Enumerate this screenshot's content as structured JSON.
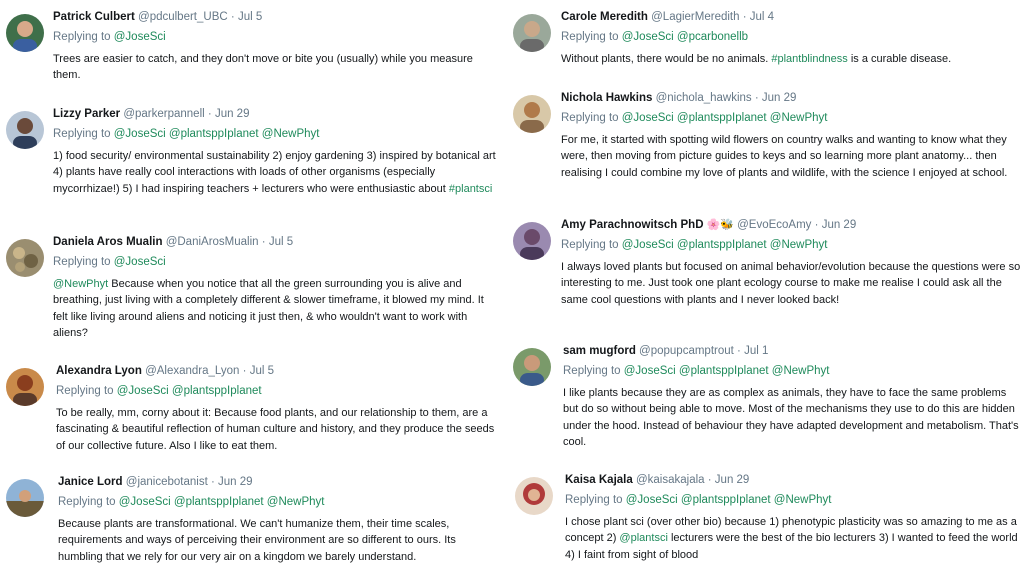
{
  "left_column": [
    {
      "name": "Patrick Culbert",
      "handle": "@pdculbert_UBC",
      "date": "Jul 5",
      "replying_label": "Replying to",
      "mentions": [
        "@JoseSci"
      ],
      "text_parts": [
        "Trees are easier to catch, and they don't move or bite you (usually) while you measure them."
      ],
      "avatar_color": "#4a7fb0"
    },
    {
      "name": "Lizzy Parker",
      "handle": "@parkerpannell",
      "date": "Jun 29",
      "replying_label": "Replying to",
      "mentions": [
        "@JoseSci",
        "@plantsppIplanet",
        "@NewPhyt"
      ],
      "text_parts": [
        "1) food security/ environmental sustainability 2) enjoy gardening 3) inspired by botanical art 4) plants have really cool interactions with loads of other organisms (especially mycorrhizae!) 5) I had inspiring teachers + lecturers who were enthusiastic about ",
        "#plantsci"
      ],
      "avatar_color": "#5a6e8c"
    },
    {
      "name": "Daniela Aros Mualin",
      "handle": "@DaniArosMualin",
      "date": "Jul 5",
      "replying_label": "Replying to",
      "mentions": [
        "@JoseSci"
      ],
      "text_parts": [
        "@NewPhyt",
        " Because when you notice that all the green surrounding you is alive and breathing, just living with a completely different & slower timeframe, it blowed my mind. It felt like living around aliens and noticing it just then, & who wouldn't want to work with aliens?"
      ],
      "avatar_color": "#8a7a5a"
    },
    {
      "name": "Alexandra Lyon",
      "handle": "@Alexandra_Lyon",
      "date": "Jul 5",
      "replying_label": "Replying to",
      "mentions": [
        "@JoseSci",
        "@plantsppIplanet"
      ],
      "text_parts": [
        "To be really, mm, corny about it: Because food plants, and our relationship to them, are a fascinating & beautiful reflection of human culture and history, and they produce the seeds of our collective future. Also I like to eat them."
      ],
      "avatar_color": "#b5652e"
    },
    {
      "name": "Janice Lord",
      "handle": "@janicebotanist",
      "date": "Jun 29",
      "replying_label": "Replying to",
      "mentions": [
        "@JoseSci",
        "@plantsppIplanet",
        "@NewPhyt"
      ],
      "text_parts": [
        "Because plants are transformational. We can't humanize them, their time scales, requirements and ways of perceiving their environment are so different to ours. Its humbling that we rely for our very air on a kingdom we barely understand."
      ],
      "avatar_color": "#6a8fb8"
    }
  ],
  "right_column": [
    {
      "name": "Carole Meredith",
      "handle": "@LagierMeredith",
      "date": "Jul 4",
      "replying_label": "Replying to",
      "mentions": [
        "@JoseSci",
        "@pcarbonellb"
      ],
      "text_parts": [
        "Without plants, there would be no animals. ",
        "#plantblindness",
        " is a curable disease."
      ],
      "avatar_color": "#7a8a7a"
    },
    {
      "name": "Nichola Hawkins",
      "handle": "@nichola_hawkins",
      "date": "Jun 29",
      "replying_label": "Replying to",
      "mentions": [
        "@JoseSci",
        "@plantsppIplanet",
        "@NewPhyt"
      ],
      "text_parts": [
        "For me, it started with spotting wild flowers on country walks and wanting to know what they were, then moving from picture guides to keys and so learning more plant anatomy... then realising I could combine my love of plants and wildlife, with the science I enjoyed at school."
      ],
      "avatar_color": "#c9a27a"
    },
    {
      "name": "Amy Parachnowitsch PhD",
      "emoji": "🌸🐝",
      "handle": "@EvoEcoAmy",
      "date": "Jun 29",
      "replying_label": "Replying to",
      "mentions": [
        "@JoseSci",
        "@plantsppIplanet",
        "@NewPhyt"
      ],
      "text_parts": [
        "I always loved plants but focused on animal behavior/evolution because the questions were so interesting to me. Just took one plant ecology course to make me realise I could ask all the same cool questions with plants and I never looked back!"
      ],
      "avatar_color": "#8a6a9a"
    },
    {
      "name": "sam mugford",
      "handle": "@popupcamptrout",
      "date": "Jul 1",
      "replying_label": "Replying to",
      "mentions": [
        "@JoseSci",
        "@plantsppIplanet",
        "@NewPhyt"
      ],
      "text_parts": [
        "I like plants because they are as complex as animals, they have to face the same problems but do so without being able to move. Most of the mechanisms they use to do this are hidden under the hood. Instead of behaviour they have adapted development and metabolism. That's cool."
      ],
      "avatar_color": "#5a7a4a"
    },
    {
      "name": "Kaisa Kajala",
      "handle": "@kaisakajala",
      "date": "Jun 29",
      "replying_label": "Replying to",
      "mentions": [
        "@JoseSci",
        "@plantsppIplanet",
        "@NewPhyt"
      ],
      "text_parts": [
        "I chose plant sci (over other bio) because 1) phenotypic plasticity was so amazing to me as a concept 2) ",
        "@plantsci",
        " lecturers were the best of the bio lecturers 3) I wanted to feed the world 4) I faint from sight of blood"
      ],
      "avatar_color": "#b03a3a"
    }
  ],
  "separator": "·"
}
